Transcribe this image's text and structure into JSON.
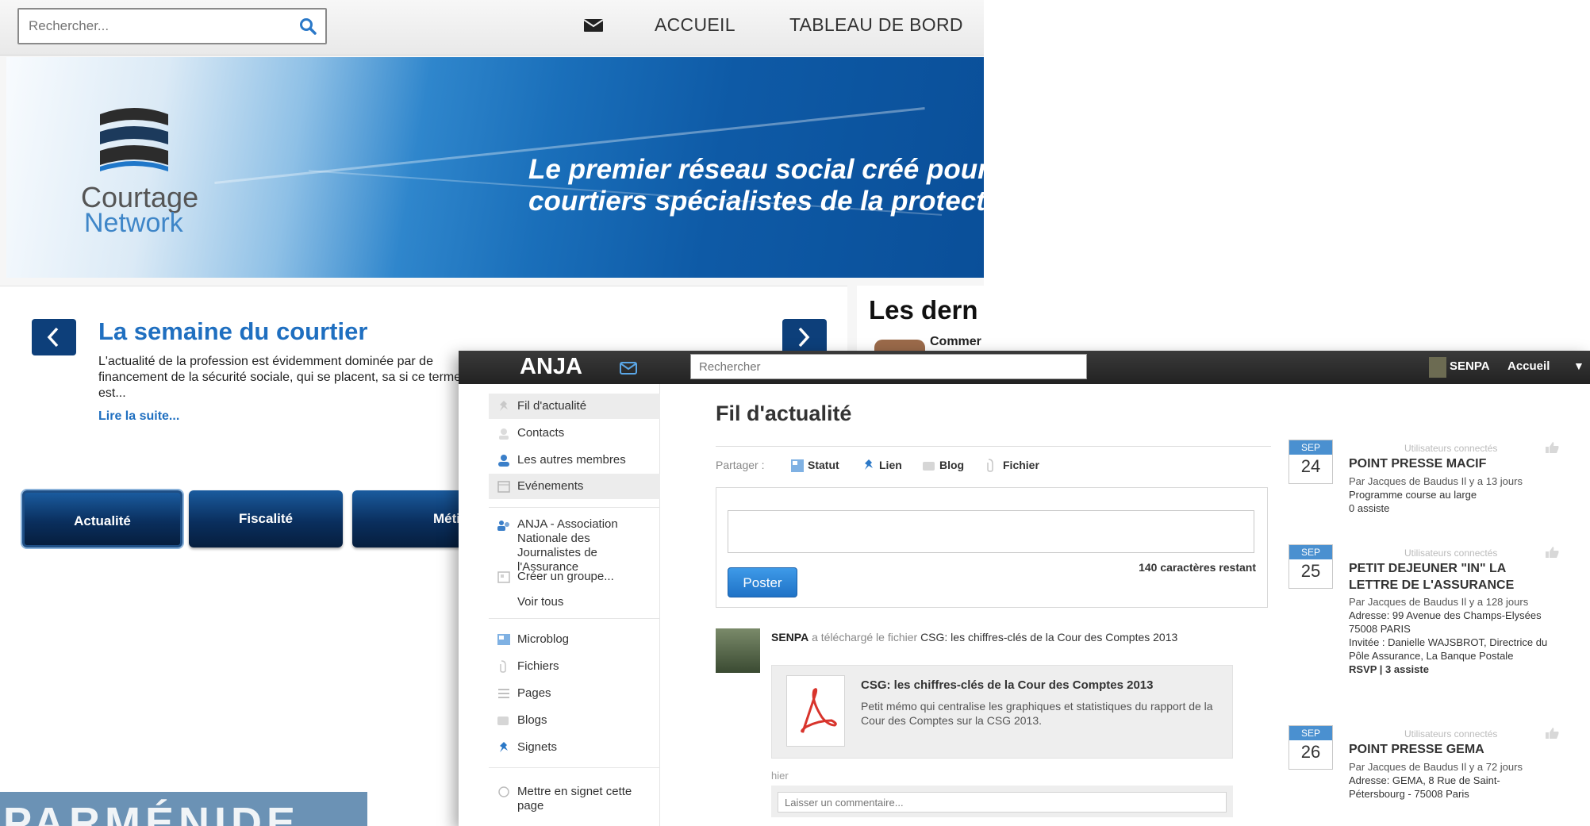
{
  "courtage": {
    "search_placeholder": "Rechercher...",
    "nav": {
      "home": "ACCUEIL",
      "dashboard": "TABLEAU DE BORD"
    },
    "logo": {
      "line1": "Courtage",
      "line2": "Network"
    },
    "tagline": {
      "line1": "Le premier réseau social créé pour les",
      "line2": "courtiers spécialistes de la protection"
    },
    "widget": {
      "title": "La semaine du courtier",
      "excerpt": "L'actualité de la profession est évidemment dominée par de financement de la sécurité sociale, qui se placent, sa si ce terme est...",
      "read_more": "Lire la suite..."
    },
    "tabs": [
      "Actualité",
      "Fiscalité",
      "Métier"
    ],
    "latest_heading": "Les dern",
    "latest_item": "Commer"
  },
  "bottom_thumb_text": "PARMÉNIDE",
  "anja": {
    "brand": "ANJA",
    "search_placeholder": "Rechercher",
    "user": "SENPA",
    "home": "Accueil",
    "caret": "▼",
    "sidebar": [
      {
        "label": "Fil d'actualité",
        "icon": "pin-icon"
      },
      {
        "label": "Contacts",
        "icon": "contacts-icon"
      },
      {
        "label": "Les autres membres",
        "icon": "user-icon"
      },
      {
        "label": "Evénements",
        "icon": "calendar-icon"
      },
      {
        "label": "ANJA - Association Nationale des Journalistes de l'Assurance",
        "icon": "group-icon"
      },
      {
        "label": "Créer un groupe...",
        "icon": "create-group-icon"
      },
      {
        "label": "Voir tous",
        "icon": ""
      },
      {
        "label": "Microblog",
        "icon": "microblog-icon"
      },
      {
        "label": "Fichiers",
        "icon": "file-icon"
      },
      {
        "label": "Pages",
        "icon": "pages-icon"
      },
      {
        "label": "Blogs",
        "icon": "blog-icon"
      },
      {
        "label": "Signets",
        "icon": "bookmark-icon"
      },
      {
        "label": "Mettre en signet cette page",
        "icon": "bookmark-page-icon"
      }
    ],
    "main": {
      "title": "Fil d'actualité",
      "share_label": "Partager :",
      "share_options": [
        "Statut",
        "Lien",
        "Blog",
        "Fichier"
      ],
      "chars_remaining": "140 caractères restant",
      "post_button": "Poster",
      "activity": {
        "user": "SENPA",
        "action": " a téléchargé le fichier ",
        "file": "CSG: les chiffres-clés de la Cour des Comptes 2013",
        "card_title": "CSG: les chiffres-clés de la Cour des Comptes 2013",
        "card_desc": "Petit mémo qui centralise les graphiques et statistiques du rapport de la Cour des Comptes sur la CSG 2013.",
        "time": "hier",
        "comment_placeholder": "Laisser un commentaire..."
      }
    },
    "events": [
      {
        "month": "SEP",
        "day": "24",
        "connected": "Utilisateurs connectés",
        "title": "POINT PRESSE MACIF",
        "meta": "Par Jacques de Baudus Il y a 13 jours",
        "lines": [
          "Programme course au large",
          "0 assiste"
        ]
      },
      {
        "month": "SEP",
        "day": "25",
        "connected": "Utilisateurs connectés",
        "title": "PETIT DEJEUNER \"IN\" LA LETTRE DE L'ASSURANCE",
        "meta": "Par Jacques de Baudus Il y a 128 jours",
        "lines": [
          "Adresse: 99 Avenue des Champs-Elysées 75008 PARIS",
          "Invitée : Danielle WAJSBROT, Directrice du Pôle Assurance, La Banque Postale",
          "RSVP | 3 assiste"
        ]
      },
      {
        "month": "SEP",
        "day": "26",
        "connected": "Utilisateurs connectés",
        "title": "POINT PRESSE GEMA",
        "meta": "Par Jacques de Baudus Il y a 72 jours",
        "lines": [
          "Adresse: GEMA, 8 Rue de Saint-Pétersbourg - 75008 Paris"
        ]
      }
    ]
  },
  "colors": {
    "accent": "#1f6fc0",
    "dark_nav": "#0d3f7a",
    "anja_bar": "#2b2b2b",
    "post_button": "#2a82d6"
  }
}
